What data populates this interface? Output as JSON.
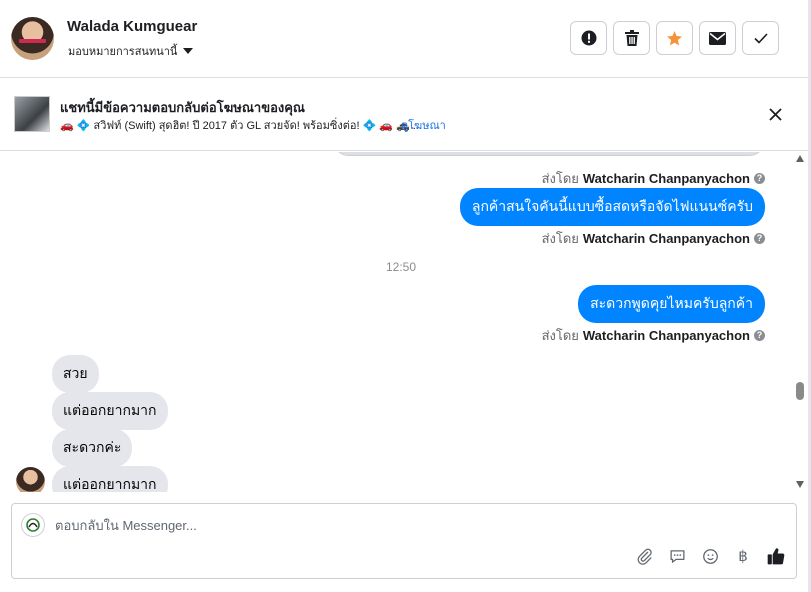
{
  "header": {
    "contact_name": "Walada Kumguear",
    "assign_label": "มอบหมายการสนทนานี้",
    "actions": [
      {
        "name": "report-button",
        "icon": "exclamation-icon"
      },
      {
        "name": "delete-button",
        "icon": "trash-icon"
      },
      {
        "name": "star-button",
        "icon": "star-icon"
      },
      {
        "name": "mark-unread-button",
        "icon": "envelope-icon"
      },
      {
        "name": "done-button",
        "icon": "checkmark-icon"
      }
    ],
    "star_color": "#f7923b"
  },
  "banner": {
    "title": "แชทนี้มีข้อความตอบกลับต่อโฆษณาของคุณ",
    "subtitle": "🚗 💠 สวิฟท์ (Swift) สุดฮิต! ปี 2017 ตัว GL สวยจัด! พร้อมซิ่งต่อ! 💠 🚗 🚓 ...",
    "link": "ดูโฆษณา"
  },
  "chat": {
    "sent_by_prefix": "ส่งโดย",
    "sender": "Watcharin Chanpanyachon",
    "outgoing": [
      "ลูกค้าสนใจคันนี้แบบซื้อสดหรือจัดไฟแนนซ์ครับ",
      "สะดวกพูดคุยไหมครับลูกค้า"
    ],
    "timestamp": "12:50",
    "incoming": [
      "สวย",
      "แต่ออกยากมาก",
      "สะดวกค่ะ",
      "แต่ออกยากมาก"
    ],
    "bubble_color": "#0084ff"
  },
  "composer": {
    "placeholder": "ตอบกลับใน Messenger...",
    "tools": [
      "paperclip-icon",
      "chat-bubble-icon",
      "smiley-icon",
      "baht-icon",
      "thumbs-up-icon"
    ],
    "baht_symbol": "฿"
  }
}
